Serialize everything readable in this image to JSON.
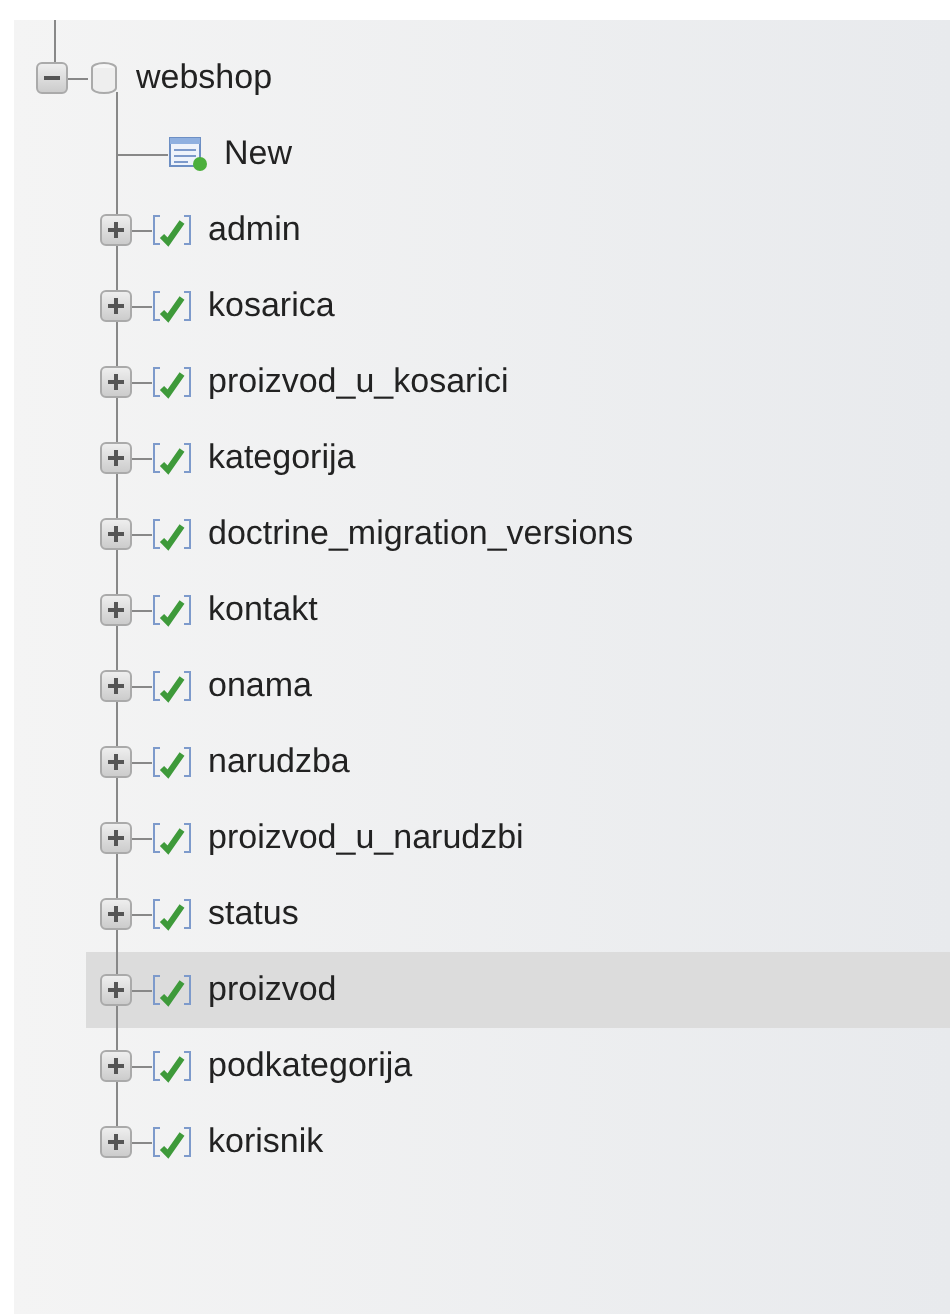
{
  "tree": {
    "label": "webshop",
    "expanded": true,
    "children": [
      {
        "kind": "new",
        "label": "New"
      },
      {
        "kind": "table",
        "label": "admin",
        "expanded": false,
        "selected": false
      },
      {
        "kind": "table",
        "label": "kosarica",
        "expanded": false,
        "selected": false
      },
      {
        "kind": "table",
        "label": "proizvod_u_kosarici",
        "expanded": false,
        "selected": false
      },
      {
        "kind": "table",
        "label": "kategorija",
        "expanded": false,
        "selected": false
      },
      {
        "kind": "table",
        "label": "doctrine_migration_versions",
        "expanded": false,
        "selected": false
      },
      {
        "kind": "table",
        "label": "kontakt",
        "expanded": false,
        "selected": false
      },
      {
        "kind": "table",
        "label": "onama",
        "expanded": false,
        "selected": false
      },
      {
        "kind": "table",
        "label": "narudzba",
        "expanded": false,
        "selected": false
      },
      {
        "kind": "table",
        "label": "proizvod_u_narudzbi",
        "expanded": false,
        "selected": false
      },
      {
        "kind": "table",
        "label": "status",
        "expanded": false,
        "selected": false
      },
      {
        "kind": "table",
        "label": "proizvod",
        "expanded": false,
        "selected": true
      },
      {
        "kind": "table",
        "label": "podkategorija",
        "expanded": false,
        "selected": false
      },
      {
        "kind": "table",
        "label": "korisnik",
        "expanded": false,
        "selected": false
      }
    ]
  }
}
